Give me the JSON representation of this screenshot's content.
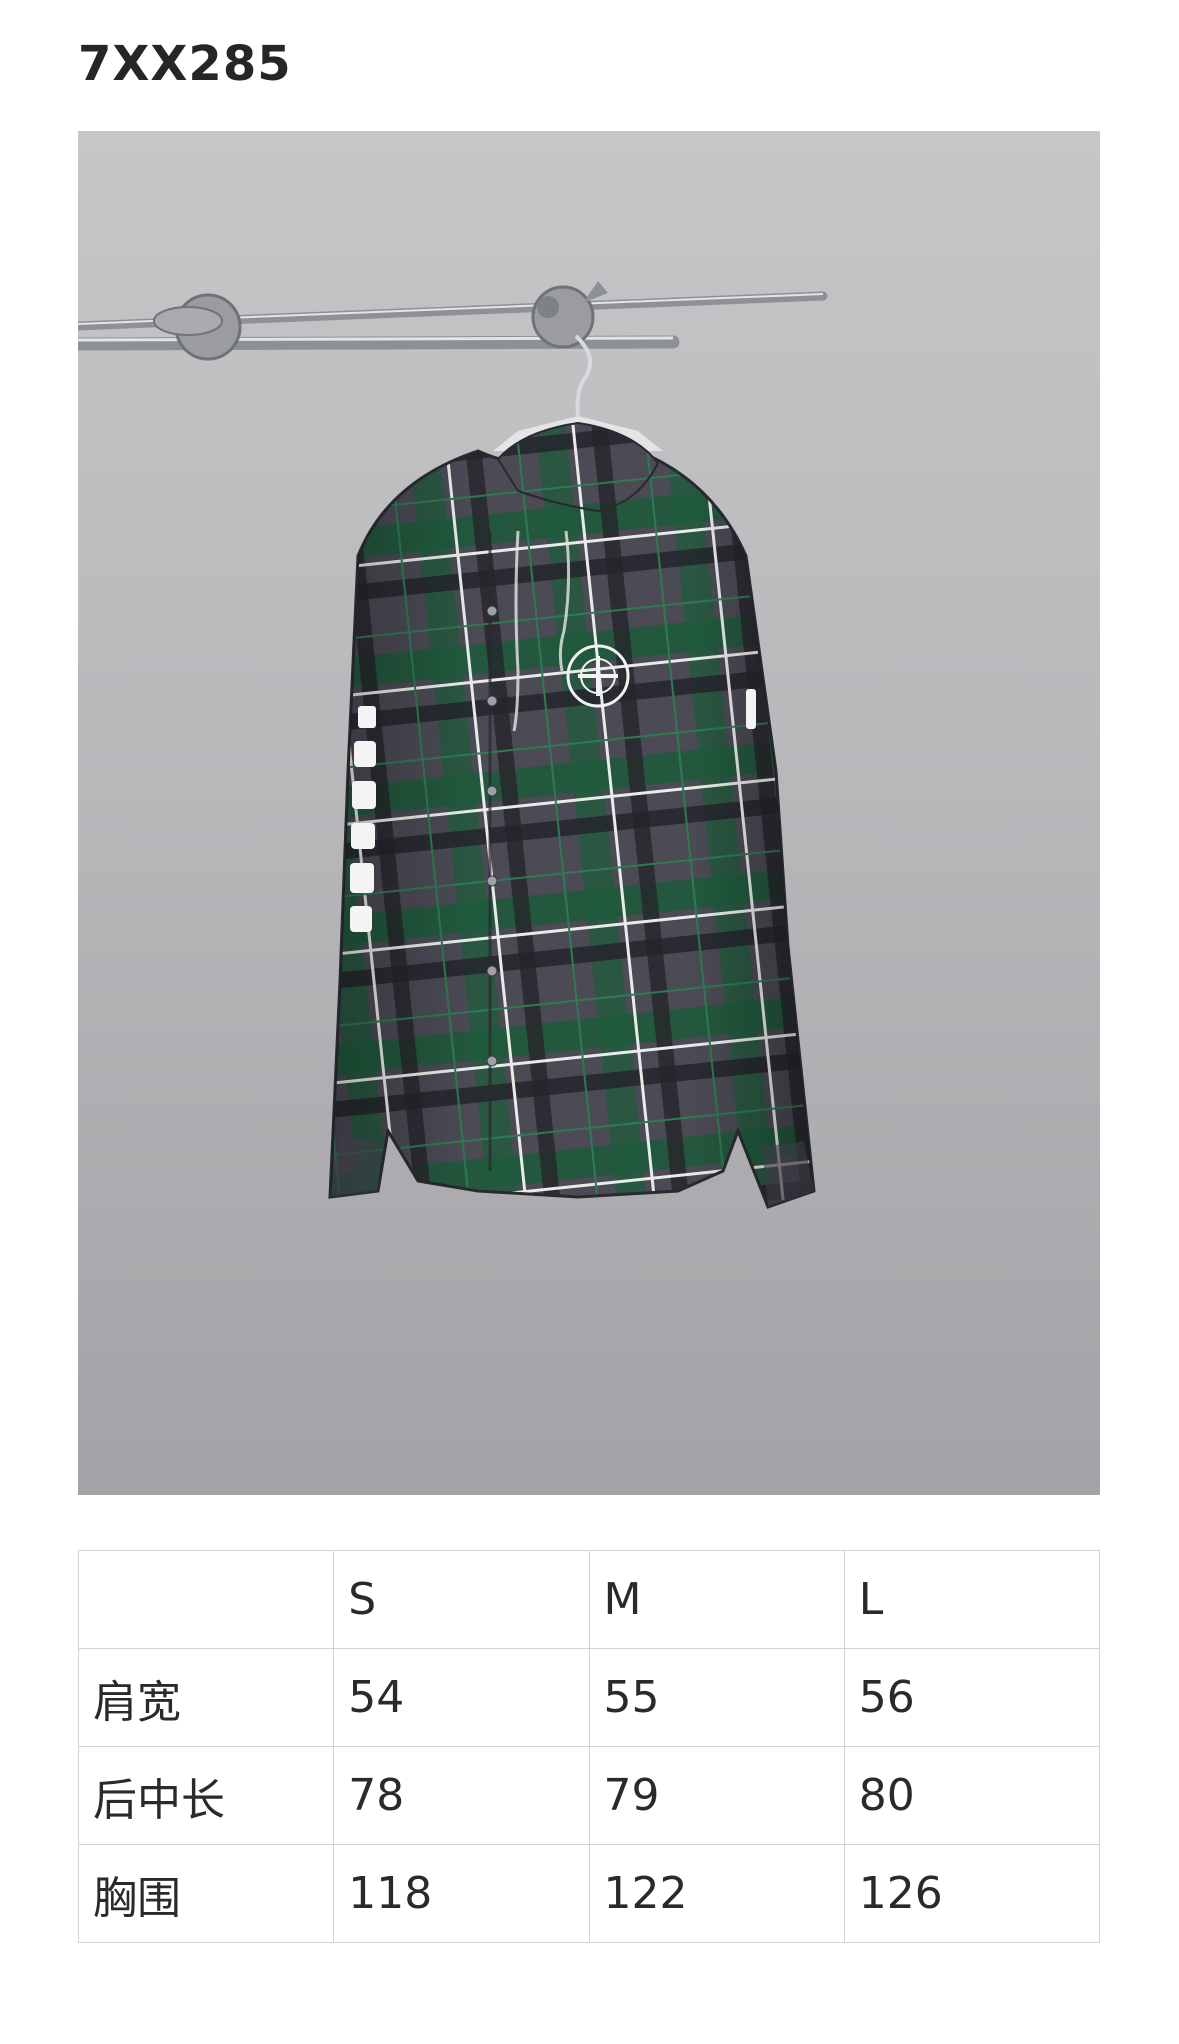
{
  "product": {
    "code": "7XX285"
  },
  "photo": {
    "label": "product-photo",
    "shirt_colors": {
      "base": "#4b4a55",
      "green": "#1f5a3c",
      "dark": "#25242b",
      "white": "#e8ece8"
    }
  },
  "size_table": {
    "header": [
      "",
      "S",
      "M",
      "L"
    ],
    "rows": [
      {
        "label": "肩宽",
        "values": [
          "54",
          "55",
          "56"
        ]
      },
      {
        "label": "后中长",
        "values": [
          "78",
          "79",
          "80"
        ]
      },
      {
        "label": "胸围",
        "values": [
          "118",
          "122",
          "126"
        ]
      }
    ]
  }
}
